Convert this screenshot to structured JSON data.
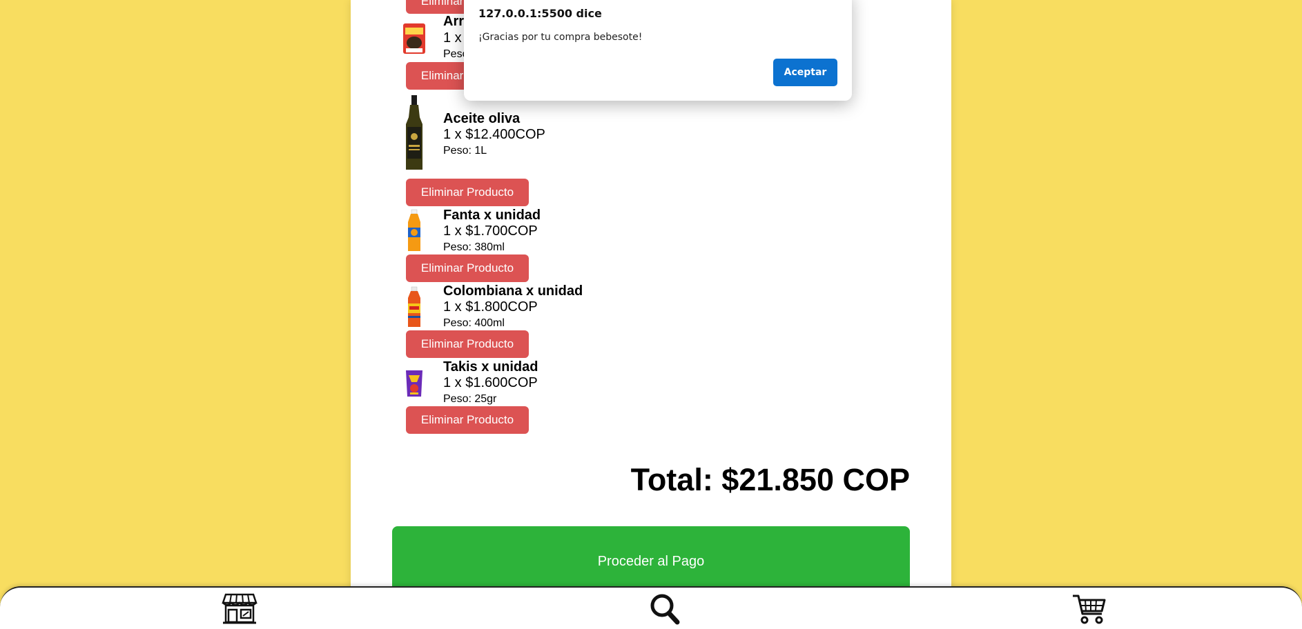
{
  "cart": {
    "remove_label": "Eliminar Producto",
    "items": [
      {
        "name": "Arr",
        "qty": "1 x",
        "weight": "Peso"
      },
      {
        "name": "Aceite oliva",
        "qty": "1 x $12.400COP",
        "weight": "Peso: 1L"
      },
      {
        "name": "Fanta x unidad",
        "qty": "1 x $1.700COP",
        "weight": "Peso: 380ml"
      },
      {
        "name": "Colombiana x unidad",
        "qty": "1 x $1.800COP",
        "weight": "Peso: 400ml"
      },
      {
        "name": "Takis x unidad",
        "qty": "1 x $1.600COP",
        "weight": "Peso: 25gr"
      }
    ],
    "total": "Total: $21.850 COP",
    "pay_label": "Proceder al Pago"
  },
  "dialog": {
    "title": "127.0.0.1:5500 dice",
    "message": "¡Gracias por tu compra bebesote!",
    "ok_label": "Aceptar"
  },
  "bottom_nav": {
    "items": [
      {
        "icon": "store-icon"
      },
      {
        "icon": "search-icon"
      },
      {
        "icon": "cart-icon"
      }
    ]
  },
  "colors": {
    "background": "#f8dd60",
    "remove_button": "#dc5353",
    "pay_button": "#2db33a",
    "dialog_ok": "#0c72d0"
  }
}
